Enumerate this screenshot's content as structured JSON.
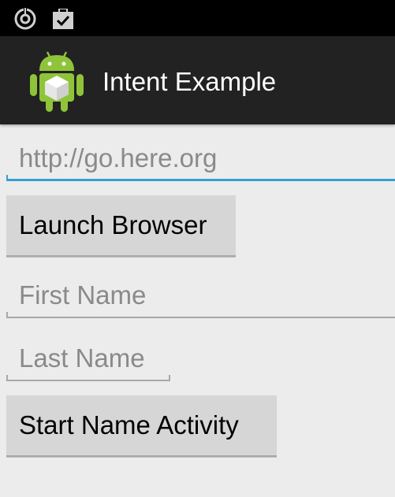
{
  "status_bar": {
    "icons": [
      "sync-icon",
      "clipboard-check-icon"
    ]
  },
  "action_bar": {
    "icon": "android-app-icon",
    "title": "Intent Example"
  },
  "url_input": {
    "placeholder": "http://go.here.org",
    "value": ""
  },
  "launch_button": {
    "label": "Launch Browser"
  },
  "first_name_input": {
    "placeholder": "First Name",
    "value": ""
  },
  "last_name_input": {
    "placeholder": "Last Name",
    "value": ""
  },
  "start_button": {
    "label": "Start Name Activity"
  },
  "colors": {
    "status_bar": "#000000",
    "action_bar": "#222222",
    "background": "#ececec",
    "focus_accent": "#33a0cf",
    "button": "#d6d6d6"
  }
}
